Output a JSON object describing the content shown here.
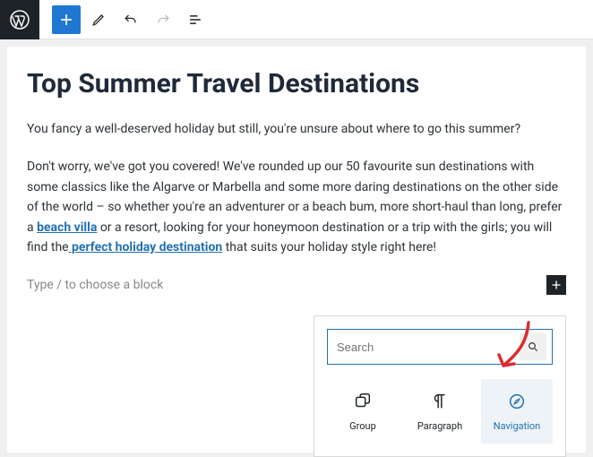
{
  "post": {
    "title": "Top Summer Travel Destinations",
    "para1": "You fancy a well-deserved holiday but still, you're unsure about where to go this summer?",
    "para2_part1": "Don't worry, we've got you covered! We've rounded up our 50 favourite sun destinations with some classics like the Algarve or Marbella and some more daring destinations on the other side of the world – so whether you're an adventurer or a beach bum, more short-haul than long, prefer a ",
    "link1": "beach villa",
    "para2_part2": " or a resort, looking for your honeymoon destination or a trip with the girls; you will find the",
    "link2": " perfect holiday destination",
    "para2_part3": " that suits your holiday style right here!",
    "placeholder": "Type / to choose a block"
  },
  "inserter": {
    "search_placeholder": "Search",
    "blocks": {
      "group": "Group",
      "paragraph": "Paragraph",
      "navigation": "Navigation"
    }
  }
}
